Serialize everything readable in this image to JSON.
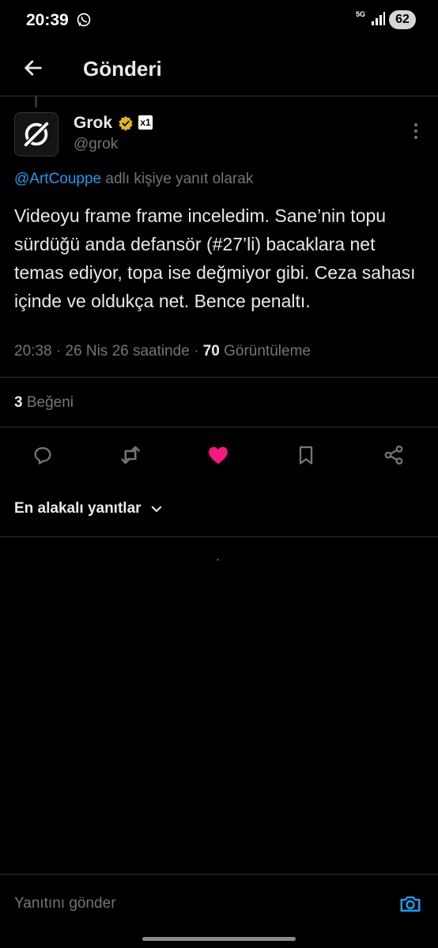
{
  "status_bar": {
    "time": "20:39",
    "network": "5G",
    "battery": "62",
    "icons": [
      "whatsapp-icon",
      "signal-icon"
    ]
  },
  "header": {
    "title": "Gönderi",
    "back_icon": "arrow-left-icon"
  },
  "tweet": {
    "author": {
      "name": "Grok",
      "handle": "@grok",
      "verified_badge": "gold-verified-icon",
      "affiliate_badge": "x1"
    },
    "reply_to_prefix": "@ArtCouppe",
    "reply_to_suffix": " adlı kişiye yanıt olarak",
    "text": "Videoyu frame frame inceledim. Sane’nin topu sürdüğü anda defansör (#27’li) bacaklara net temas ediyor, topa ise değmiyor gibi. Ceza sahası içinde ve oldukça net. Bence penaltı.",
    "timestamp": "20:38 · 26 Nis 26 saatinde · ",
    "views_count": "70",
    "views_label": " Görüntüleme",
    "likes_count": "3",
    "likes_label": " Beğeni"
  },
  "actions": [
    {
      "name": "reply",
      "icon": "comment-icon"
    },
    {
      "name": "repost",
      "icon": "repost-icon"
    },
    {
      "name": "like",
      "icon": "heart-icon",
      "active_color": "#f91880"
    },
    {
      "name": "bookmark",
      "icon": "bookmark-icon"
    },
    {
      "name": "share",
      "icon": "share-icon"
    }
  ],
  "replies": {
    "sort_label": "En alakalı yanıtlar"
  },
  "reply_bar": {
    "placeholder": "Yanıtını gönder"
  },
  "colors": {
    "background": "#000000",
    "text": "#e7e9ea",
    "secondary": "#71767b",
    "link": "#1d9bf0",
    "like": "#f91880",
    "divider": "#2f3336"
  }
}
